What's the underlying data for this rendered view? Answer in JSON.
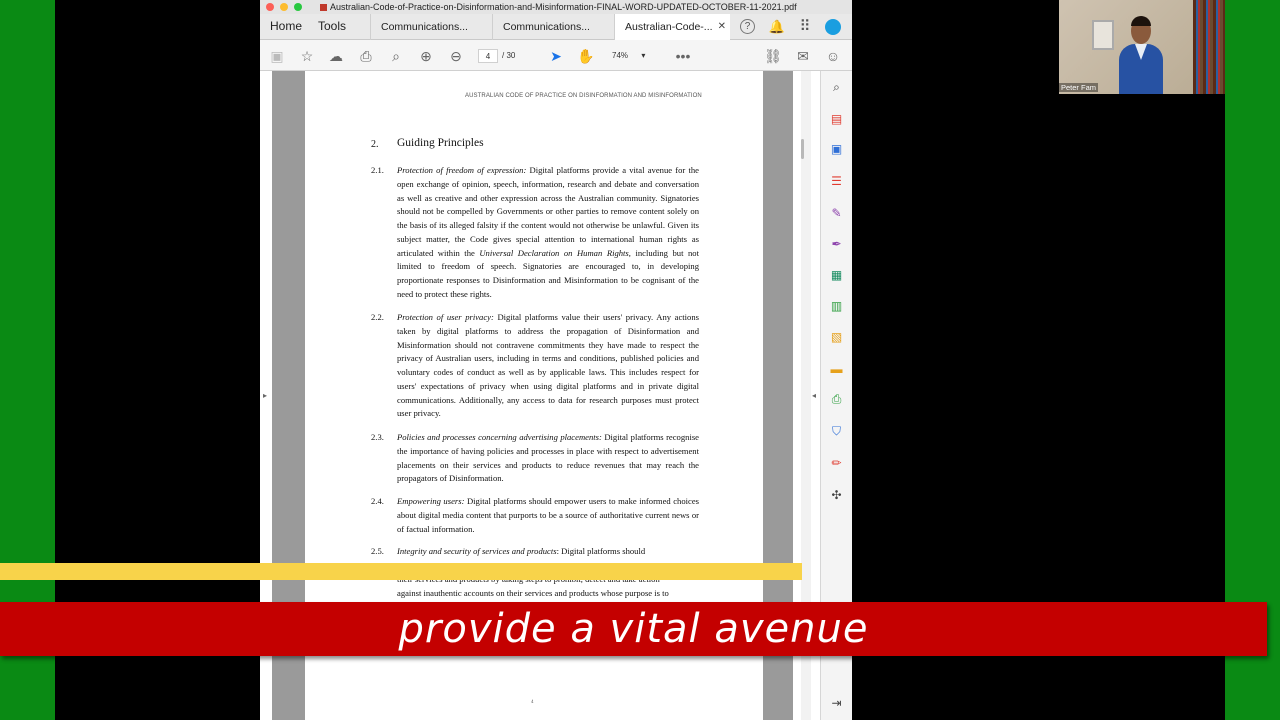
{
  "window": {
    "title": "Australian-Code-of-Practice-on-Disinformation-and-Misinformation-FINAL-WORD-UPDATED-OCTOBER-11-2021.pdf"
  },
  "tabs": {
    "home": "Home",
    "tools": "Tools",
    "docs": [
      {
        "label": "Communications..."
      },
      {
        "label": "Communications..."
      },
      {
        "label": "Australian-Code-..."
      }
    ]
  },
  "toolbar": {
    "page_current": "4",
    "page_total": "/ 30",
    "zoom": "74%"
  },
  "document": {
    "header": "AUSTRALIAN CODE OF PRACTICE ON DISINFORMATION AND MISINFORMATION",
    "section_number": "2.",
    "section_title": "Guiding Principles",
    "paragraphs": [
      {
        "num": "2.1.",
        "heading": "Protection of freedom of expression:",
        "text_a": " Digital platforms provide a vital avenue for the open exchange of opinion, speech, information, research and debate and conversation as well as creative and other expression across the Australian community. Signatories should not be compelled by Governments or other parties to remove content solely on the basis of its alleged falsity if the content would not otherwise be unlawful. Given its subject matter, the Code gives special attention to international human rights as articulated within the ",
        "text_italic": "Universal Declaration on Human Rights",
        "text_b": ", including but not limited to freedom of speech. Signatories are encouraged to, in developing proportionate responses to Disinformation and Misinformation to be cognisant of the need to protect these rights."
      },
      {
        "num": "2.2.",
        "heading": "Protection of user privacy:",
        "text_a": " Digital platforms value their users' privacy. Any actions taken by digital platforms to address the propagation of Disinformation and Misinformation should not contravene commitments they have made to respect the privacy of Australian users, including in terms and conditions, published policies and voluntary codes of conduct as well as by applicable laws. This includes respect for users' expectations of privacy when using digital platforms and in private digital communications. Additionally, any access to data for research purposes must protect user privacy."
      },
      {
        "num": "2.3.",
        "heading": "Policies and processes concerning advertising placements:",
        "text_a": " Digital platforms recognise the importance of having policies and processes in place with respect to advertisement placements on their services and products to reduce revenues that may reach the propagators of Disinformation."
      },
      {
        "num": "2.4.",
        "heading": "Empowering users:",
        "text_a": " Digital platforms should empower users to make informed choices about digital media content that purports to be a source of authoritative current news or of factual information."
      },
      {
        "num": "2.5.",
        "heading": "Integrity and security of services and products",
        "text_a": ": Digital platforms should"
      }
    ],
    "partial_line_1": "their services and products by taking steps to prohibit, detect and take action",
    "partial_line_2": "against inauthentic accounts on their services and products whose purpose is to",
    "page_footer": "4"
  },
  "webcam": {
    "name": "Peter Fam"
  },
  "caption": {
    "text": "provide a vital avenue"
  },
  "colors": {
    "background_green": "#0a8a14",
    "caption_red": "#c40000",
    "highlight_yellow": "#f8d34a"
  }
}
